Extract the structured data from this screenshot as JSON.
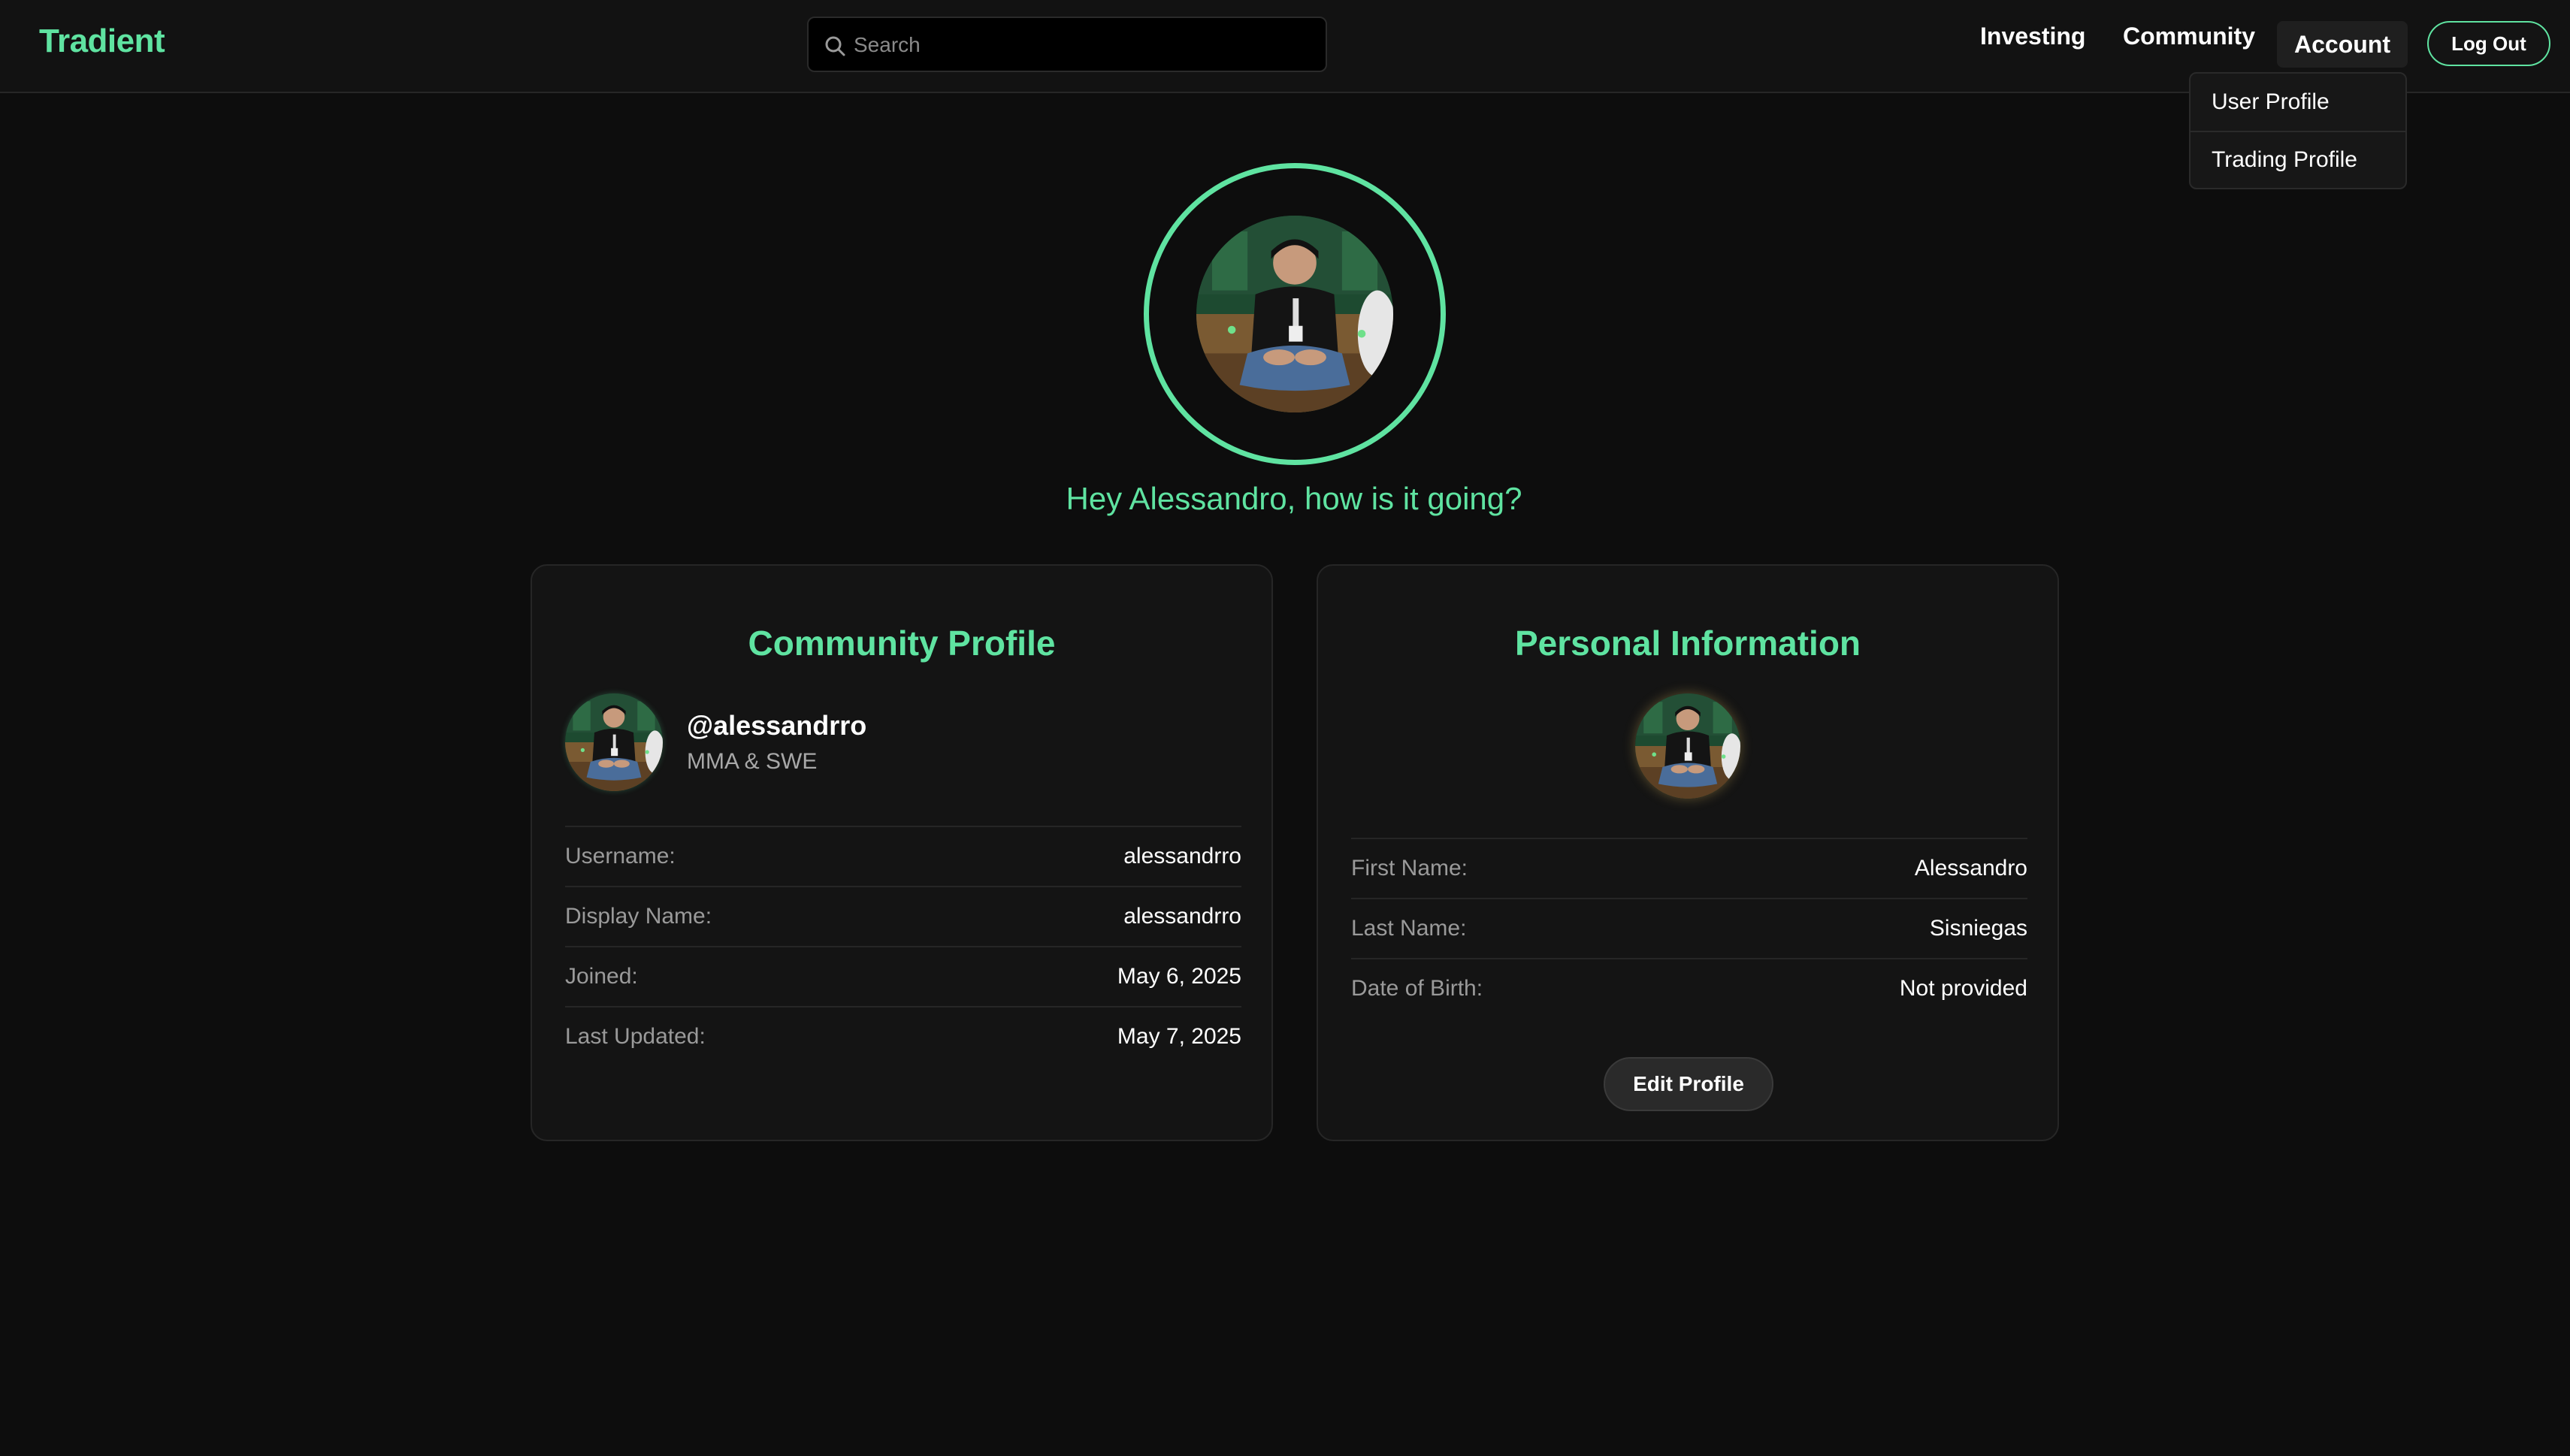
{
  "header": {
    "logo": "Tradient",
    "search": {
      "placeholder": "Search",
      "value": ""
    },
    "nav": {
      "investing": "Investing",
      "community": "Community",
      "account": "Account"
    },
    "logout": "Log Out"
  },
  "account_menu": {
    "items": [
      {
        "label": "User Profile"
      },
      {
        "label": "Trading Profile"
      }
    ]
  },
  "hero": {
    "greeting": "Hey Alessandro, how is it going?"
  },
  "community_profile": {
    "title": "Community Profile",
    "handle": "@alessandrro",
    "bio": "MMA & SWE",
    "rows": [
      {
        "label": "Username:",
        "value": "alessandrro"
      },
      {
        "label": "Display Name:",
        "value": "alessandrro"
      },
      {
        "label": "Joined:",
        "value": "May 6, 2025"
      },
      {
        "label": "Last Updated:",
        "value": "May 7, 2025"
      }
    ]
  },
  "personal_info": {
    "title": "Personal Information",
    "rows": [
      {
        "label": "First Name:",
        "value": "Alessandro"
      },
      {
        "label": "Last Name:",
        "value": "Sisniegas"
      },
      {
        "label": "Date of Birth:",
        "value": "Not provided"
      }
    ],
    "edit_button": "Edit Profile"
  },
  "icons": {
    "search": "search-icon",
    "avatar": "avatar-photo"
  },
  "colors": {
    "accent": "#5fe3a1",
    "background": "#0d0d0d",
    "card": "#141414"
  }
}
